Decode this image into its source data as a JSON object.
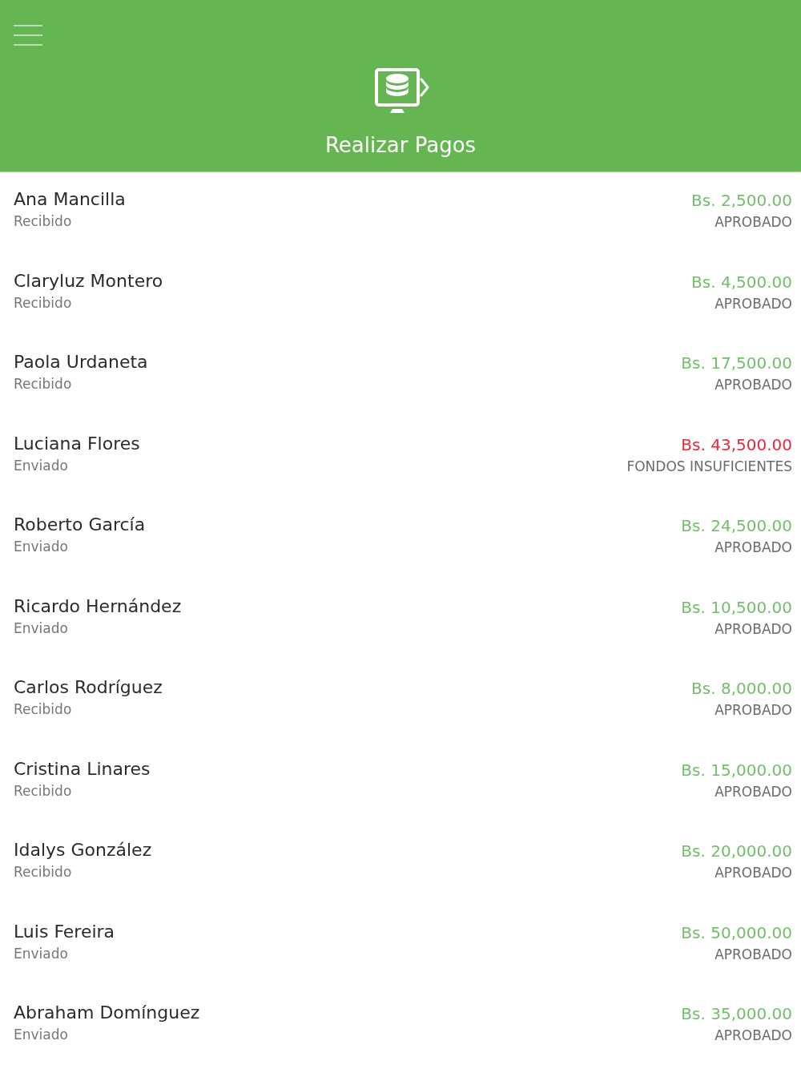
{
  "header": {
    "title": "Realizar Pagos"
  },
  "payments": [
    {
      "name": "Ana Mancilla",
      "direction": "Recibido",
      "amount": "Bs. 2,500.00",
      "color": "#72bf6a",
      "status": "APROBADO"
    },
    {
      "name": "Claryluz Montero",
      "direction": "Recibido",
      "amount": "Bs. 4,500.00",
      "color": "#72bf6a",
      "status": "APROBADO"
    },
    {
      "name": "Paola Urdaneta",
      "direction": "Recibido",
      "amount": "Bs. 17,500.00",
      "color": "#72bf6a",
      "status": "APROBADO"
    },
    {
      "name": "Luciana Flores",
      "direction": "Enviado",
      "amount": "Bs. 43,500.00",
      "color": "#e8283c",
      "status": "FONDOS INSUFICIENTES"
    },
    {
      "name": "Roberto García",
      "direction": "Enviado",
      "amount": "Bs. 24,500.00",
      "color": "#72bf6a",
      "status": "APROBADO"
    },
    {
      "name": "Ricardo Hernández",
      "direction": "Enviado",
      "amount": "Bs. 10,500.00",
      "color": "#72bf6a",
      "status": "APROBADO"
    },
    {
      "name": "Carlos Rodríguez",
      "direction": "Recibido",
      "amount": "Bs. 8,000.00",
      "color": "#72bf6a",
      "status": "APROBADO"
    },
    {
      "name": "Cristina Linares",
      "direction": "Recibido",
      "amount": "Bs. 15,000.00",
      "color": "#72bf6a",
      "status": "APROBADO"
    },
    {
      "name": "Idalys González",
      "direction": "Recibido",
      "amount": "Bs. 20,000.00",
      "color": "#72bf6a",
      "status": "APROBADO"
    },
    {
      "name": "Luis Fereira",
      "direction": "Enviado",
      "amount": "Bs. 50,000.00",
      "color": "#72bf6a",
      "status": "APROBADO"
    },
    {
      "name": "Abraham Domínguez",
      "direction": "Enviado",
      "amount": "Bs. 35,000.00",
      "color": "#72bf6a",
      "status": "APROBADO"
    }
  ]
}
